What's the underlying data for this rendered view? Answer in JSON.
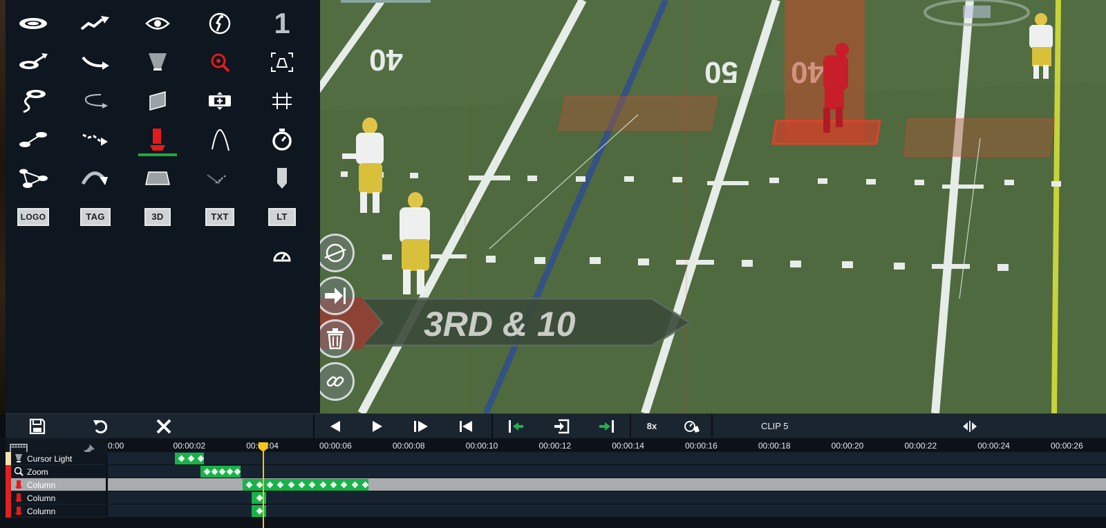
{
  "tools": {
    "logo_label": "LOGO",
    "tag_label": "TAG",
    "three_d_label": "3D",
    "txt_label": "TXT",
    "lt_label": "LT",
    "number_label": "1"
  },
  "video": {
    "yard_left": "40",
    "yard_mid_a": "50",
    "yard_mid_b": "40",
    "down_distance": "3RD & 10"
  },
  "toolbar": {
    "speed_label": "8x",
    "clip_label": "CLIP 5"
  },
  "timeline": {
    "ticks": [
      "0:00",
      "00:00:02",
      "00:00:04",
      "00:00:06",
      "00:00:08",
      "00:00:10",
      "00:00:12",
      "00:00:14",
      "00:00:16",
      "00:00:18",
      "00:00:20",
      "00:00:22",
      "00:00:24",
      "00:00:26"
    ],
    "playhead_seconds": 4.02,
    "tracks": [
      {
        "name": "Cursor Light",
        "color": "#f3e0b0",
        "selected": false,
        "clips": [
          {
            "start": 1.6,
            "end": 2.4,
            "keyframes": 3
          }
        ]
      },
      {
        "name": "Zoom",
        "color": "#e02020",
        "selected": false,
        "clips": [
          {
            "start": 2.3,
            "end": 3.4,
            "keyframes": 5
          }
        ]
      },
      {
        "name": "Column",
        "color": "#e02020",
        "selected": true,
        "clips": [
          {
            "start": 3.45,
            "end": 6.9,
            "keyframes": 12
          }
        ]
      },
      {
        "name": "Column",
        "color": "#e02020",
        "selected": false,
        "clips": [
          {
            "start": 3.7,
            "end": 4.1,
            "keyframes": 1
          }
        ]
      },
      {
        "name": "Column",
        "color": "#e02020",
        "selected": false,
        "clips": [
          {
            "start": 3.7,
            "end": 4.1,
            "keyframes": 1
          }
        ]
      }
    ]
  },
  "colors": {
    "accent_green": "#18b24a",
    "playhead": "#f5c518",
    "timeline_red": "#c62828",
    "highlight_red": "#e02020"
  }
}
